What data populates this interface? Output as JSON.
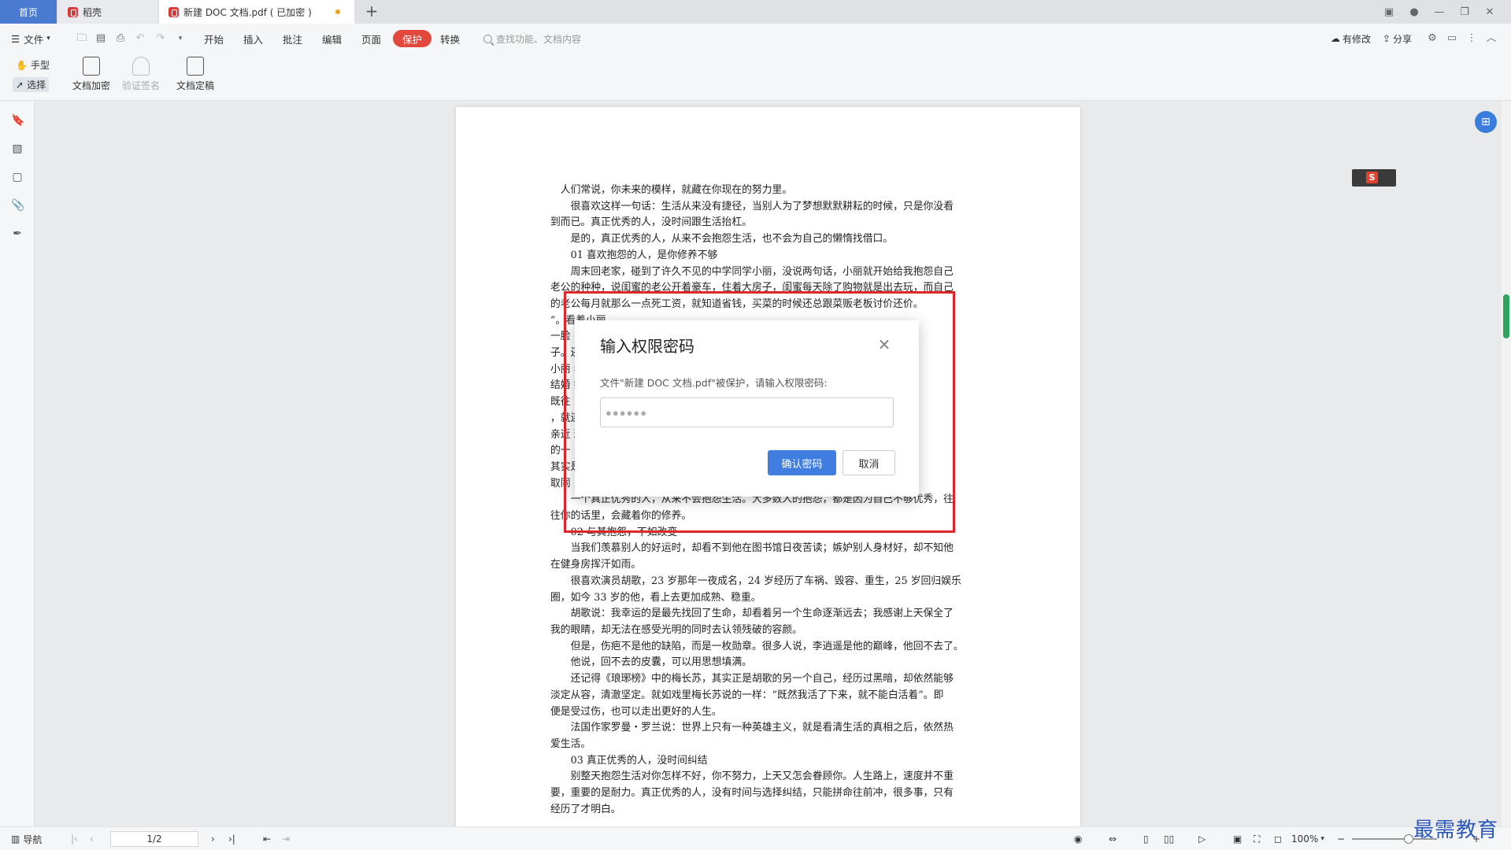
{
  "tabs": {
    "home": "首页",
    "wps": "稻壳",
    "doc": "新建 DOC 文档.pdf ( 已加密 )",
    "new_tab": "+"
  },
  "menubar": {
    "file": "文件",
    "items": [
      "开始",
      "插入",
      "批注",
      "编辑",
      "页面",
      "保护",
      "转换"
    ],
    "search_placeholder": "查找功能、文档内容",
    "right": {
      "modified": "有修改",
      "share": "分享"
    }
  },
  "ribbon": {
    "hand": "手型",
    "select": "选择",
    "encrypt": "文档加密",
    "verify_sign": "验证签名",
    "finalize": "文档定稿"
  },
  "document": {
    "lines": [
      "人们常说，你未来的模样，就藏在你现在的努力里。",
      "很喜欢这样一句话：生活从来没有捷径，当别人为了梦想默默耕耘的时候，只是你没看",
      "到而已。真正优秀的人，没时间跟生活抬杠。",
      "是的，真正优秀的人，从来不会抱怨生活，也不会为自己的懒惰找借口。",
      "01  喜欢抱怨的人，是你修养不够",
      "周末回老家，碰到了许久不见的中学同学小丽，没说两句话，小丽就开始给我抱怨自己",
      "老公的种种，说闺蜜的老公开着豪车，住着大房子，闺蜜每天除了购物就是出去玩，而自己",
      "的老公每月就那么一点死工资，就知道省钱，买菜的时候还总跟菜贩老板讨价还价。",
      "                                                                                  ”。看着小丽",
      "一脸                                                                                           ",
      "                                                                                   子。还记得当初",
      "小丽                                                                              老公。可现在",
      "结婚                                                                              笑，还是一如",
      "既往                                                                                          ",
      "                                                                                   ，就连自己最",
      "亲近                                                                              琐事，是爱人",
      "的一                                                                                          ",
      "                                                                                   其实是为了获",
      "取同                                                                                          ",
      "一个真正优秀的人，从来不会抱怨生活。大多数人的抱怨，都是因为自己不够优秀，往",
      "往你的话里，会藏着你的修养。",
      "02  与其抱怨，不如改变",
      "当我们羡慕别人的好运时，却看不到他在图书馆日夜苦读；嫉妒别人身材好，却不知他",
      "在健身房挥汗如雨。",
      "很喜欢演员胡歌，23 岁那年一夜成名，24 岁经历了车祸、毁容、重生，25 岁回归娱乐",
      "圈，如今 33 岁的他，看上去更加成熟、稳重。",
      "胡歌说：我幸运的是最先找回了生命，却看着另一个生命逐渐远去；我感谢上天保全了",
      "我的眼睛，却无法在感受光明的同时去认领残破的容颜。",
      "但是，伤疤不是他的缺陷，而是一枚勋章。很多人说，李逍遥是他的巅峰，他回不去了。",
      "他说，回不去的皮囊，可以用思想填满。",
      "还记得《琅琊榜》中的梅长苏，其实正是胡歌的另一个自己，经历过黑暗，却依然能够",
      "淡定从容，清澈坚定。就如戏里梅长苏说的一样：“既然我活了下来，就不能白活着”。即",
      "便是受过伤，也可以走出更好的人生。",
      "法国作家罗曼・罗兰说：世界上只有一种英雄主义，就是看清生活的真相之后，依然热",
      "爱生活。",
      "03  真正优秀的人，没时间纠结",
      "别整天抱怨生活对你怎样不好，你不努力，上天又怎会眷顾你。人生路上，速度并不重",
      "要，重要的是耐力。真正优秀的人，没有时间与选择纠结，只能拼命往前冲，很多事，只有",
      "经历了才明白。"
    ]
  },
  "dialog": {
    "title": "输入权限密码",
    "message": "文件\"新建 DOC 文档.pdf\"被保护，请输入权限密码:",
    "password_value": "●●●●●●",
    "ok": "确认密码",
    "cancel": "取消"
  },
  "statusbar": {
    "nav": "导航",
    "page": "1/2",
    "zoom": "100%"
  },
  "watermark": "最需教育",
  "colors": {
    "accent": "#3f7ee0",
    "protect": "#e4473c",
    "highlight_box": "#e0262d"
  }
}
